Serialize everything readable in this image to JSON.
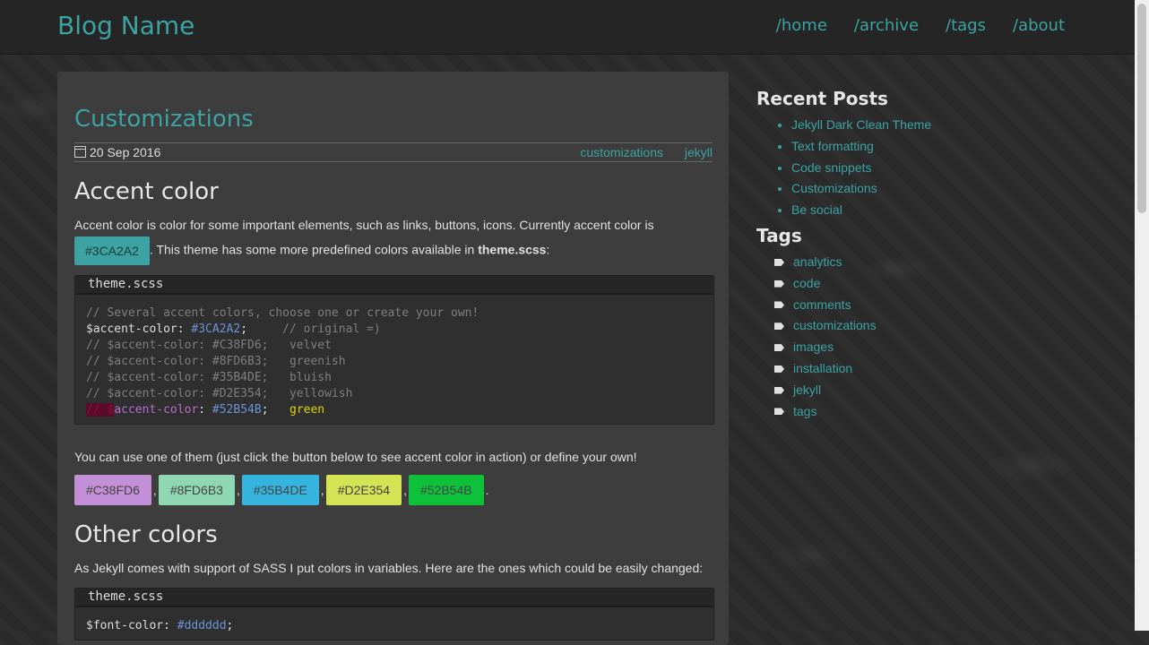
{
  "header": {
    "brand": "Blog Name",
    "nav": [
      "/home",
      "/archive",
      "/tags",
      "/about"
    ]
  },
  "post": {
    "title": "Customizations",
    "date": "20 Sep 2016",
    "tags": [
      "customizations",
      "jekyll"
    ],
    "sections": {
      "accent": {
        "heading": "Accent color",
        "intro_before": "Accent color is color for some important elements, such as links, buttons, icons. Currently accent color is",
        "accent_badge": "#3CA2A2",
        "intro_after": ". This theme has some more predefined colors available in ",
        "intro_file": "theme.scss",
        "intro_end": ":",
        "code": {
          "filename": "theme.scss",
          "lines": [
            "// Several accent colors, choose one or create your own!",
            "$accent-color: #3CA2A2;     // original =)",
            "// $accent-color: #C38FD6;   velvet",
            "// $accent-color: #8FD6B3;   greenish",
            "// $accent-color: #35B4DE;   bluish",
            "// $accent-color: #D2E354;   yellowish",
            "// $accent-color: #52B54B;   green"
          ]
        },
        "use_text": "You can use one of them (just click the button below to see accent color in action) or define your own!",
        "swatches": [
          {
            "label": "#C38FD6",
            "color": "#C38FD6"
          },
          {
            "label": "#8FD6B3",
            "color": "#8FD6B3"
          },
          {
            "label": "#35B4DE",
            "color": "#35B4DE"
          },
          {
            "label": "#D2E354",
            "color": "#D2E354"
          },
          {
            "label": "#52B54B",
            "color": "#0ec13a"
          }
        ]
      },
      "other": {
        "heading": "Other colors",
        "text": "As Jekyll comes with support of SASS I put colors in variables. Here are the ones which could be easily changed:",
        "code": {
          "filename": "theme.scss",
          "lines": [
            "$font-color: #dddddd;"
          ]
        }
      }
    }
  },
  "sidebar": {
    "recent_heading": "Recent Posts",
    "recent": [
      "Jekyll Dark Clean Theme",
      "Text formatting",
      "Code snippets",
      "Customizations",
      "Be social"
    ],
    "tags_heading": "Tags",
    "tags": [
      "analytics",
      "code",
      "comments",
      "customizations",
      "images",
      "installation",
      "jekyll",
      "tags"
    ]
  },
  "colors": {
    "accent": "#3CA2A2",
    "background": "#2b2b2b",
    "panel": "#3d3d3d",
    "text": "#dddddd"
  }
}
